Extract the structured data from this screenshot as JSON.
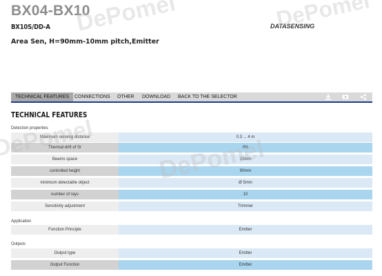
{
  "header": {
    "title": "BX04-BX10",
    "model_code": "BX10S/DD-A",
    "model_suffix": "A",
    "brand": "DATASENSING",
    "subtitle": "Area Sen, H=90mm-10mm pitch,Emitter"
  },
  "tabs": [
    {
      "label": "TECHNICAL FEATURES",
      "active": true
    },
    {
      "label": "CONNECTIONS",
      "active": false
    },
    {
      "label": "OTHER",
      "active": false
    },
    {
      "label": "DOWNLOAD",
      "active": false
    },
    {
      "label": "BACK TO THE SELECTOR",
      "active": false
    }
  ],
  "toolbar_icons": [
    "download-icon",
    "video-icon",
    "share-icon"
  ],
  "section_title": "TECHNICAL FEATURES",
  "groups": [
    {
      "title": "Detection properties",
      "rows": [
        {
          "label": "Maximum sensing distance",
          "value": "0.3 ... 4 m"
        },
        {
          "label": "Thermal drift of Sr",
          "value": "0%"
        },
        {
          "label": "Beams space",
          "value": "10mm"
        },
        {
          "label": "controlled height",
          "value": "90mm"
        },
        {
          "label": "minimum detectable object",
          "value": "Ø 5mm"
        },
        {
          "label": "number of rays",
          "value": "10"
        },
        {
          "label": "Sensitivity adjustment",
          "value": "Trimmer"
        }
      ]
    },
    {
      "title": "Application",
      "rows": [
        {
          "label": "Function Principle",
          "value": "Emitter"
        }
      ]
    },
    {
      "title": "Outputs",
      "rows": [
        {
          "label": "Output type",
          "value": "Emitter"
        },
        {
          "label": "Output Function",
          "value": "Emitter"
        }
      ]
    }
  ],
  "watermark": "DePomel",
  "colors": {
    "tab_underline": "#1e3a8a",
    "row_blue_light": "#dbe9f6",
    "row_blue": "#a9d5ef"
  }
}
